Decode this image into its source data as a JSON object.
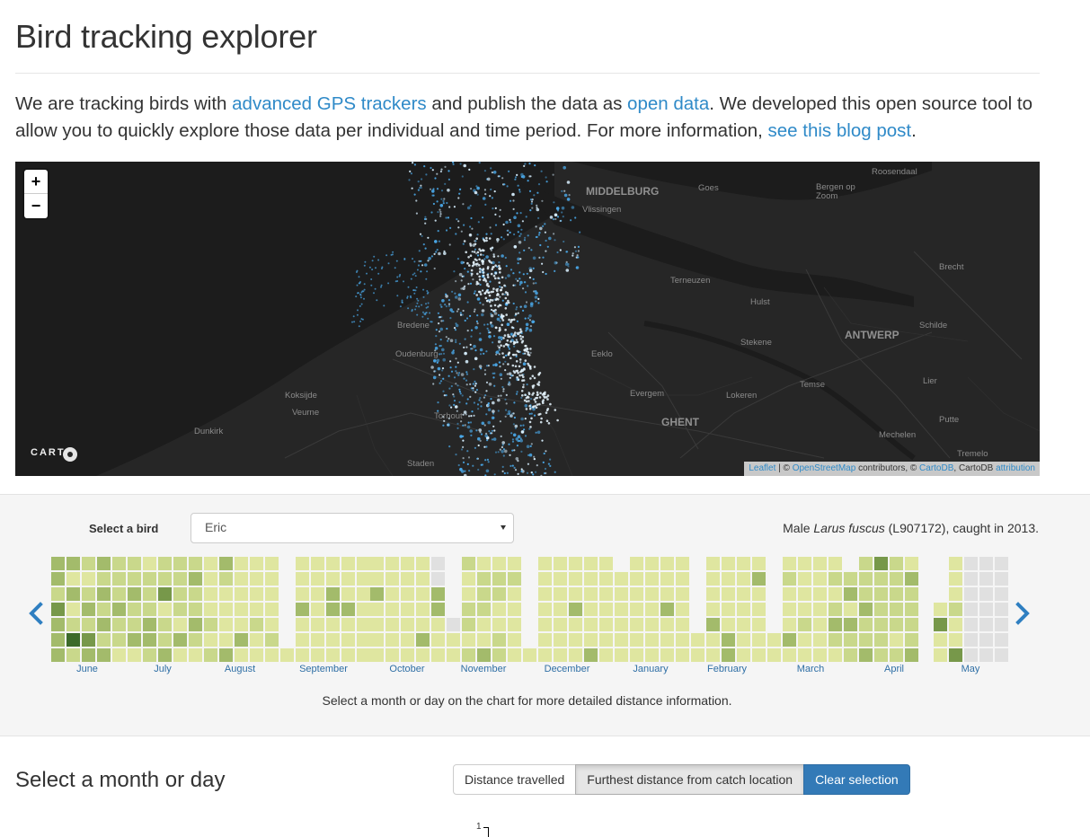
{
  "page": {
    "title": "Bird tracking explorer",
    "intro": {
      "t1": "We are tracking birds with ",
      "link1": "advanced GPS trackers",
      "t2": " and publish the data as ",
      "link2": "open data",
      "t3": ". We developed this open source tool to allow you to quickly explore those data per individual and time period. For more information, ",
      "link3": "see this blog post",
      "t4": "."
    }
  },
  "map": {
    "zoom_in": "+",
    "zoom_out": "−",
    "places": [
      {
        "name": "Roosendaal",
        "big": false
      },
      {
        "name": "MIDDELBURG",
        "big": true
      },
      {
        "name": "Goes",
        "big": false
      },
      {
        "name": "Bergen op Zoom",
        "big": false
      },
      {
        "name": "Vlissingen",
        "big": false
      },
      {
        "name": "Brecht",
        "big": false
      },
      {
        "name": "Terneuzen",
        "big": false
      },
      {
        "name": "Hulst",
        "big": false
      },
      {
        "name": "Bredene",
        "big": false
      },
      {
        "name": "Schilde",
        "big": false
      },
      {
        "name": "Stekene",
        "big": false
      },
      {
        "name": "ANTWERP",
        "big": true
      },
      {
        "name": "Oudenburg",
        "big": false
      },
      {
        "name": "Eeklo",
        "big": false
      },
      {
        "name": "Temse",
        "big": false
      },
      {
        "name": "Lier",
        "big": false
      },
      {
        "name": "Koksijde",
        "big": false
      },
      {
        "name": "Evergem",
        "big": false
      },
      {
        "name": "Lokeren",
        "big": false
      },
      {
        "name": "Veurne",
        "big": false
      },
      {
        "name": "Torhout",
        "big": false
      },
      {
        "name": "GHENT",
        "big": true
      },
      {
        "name": "Putte",
        "big": false
      },
      {
        "name": "Dunkirk",
        "big": false
      },
      {
        "name": "Mechelen",
        "big": false
      },
      {
        "name": "Staden",
        "big": false
      },
      {
        "name": "Tremelo",
        "big": false
      }
    ],
    "carto_logo": "CARTO",
    "attribution": {
      "leaflet": "Leaflet",
      "sep": " | © ",
      "osm": "OpenStreetMap",
      "contrib": " contributors, © ",
      "cartodb": "CartoDB",
      "cartodb_text": ", CartoDB ",
      "attr_link": "attribution"
    },
    "track_color": "#4aa8e8"
  },
  "calendar": {
    "select_label": "Select a bird",
    "selected_bird": "Eric",
    "bird_info": "Male Larus fuscus (L907172), caught in 2013.",
    "bird_info_parts": {
      "a": "Male ",
      "species": "Larus fuscus",
      "b": " (L907172), caught in 2013."
    },
    "months": [
      "June",
      "July",
      "August",
      "September",
      "October",
      "November",
      "December",
      "January",
      "February",
      "March",
      "April",
      "May"
    ],
    "prev_icon": "chevron-left-icon",
    "next_icon": "chevron-right-icon",
    "colors": {
      "level0": "#dfe6a0",
      "level1": "#c9d88b",
      "level2": "#a3bb6b",
      "level3": "#77984a",
      "level4": "#3c6a2a",
      "empty": "#e0e0e0"
    },
    "help_text": "Select a month or day on the chart for more detailed distance information."
  },
  "detail": {
    "title": "Select a month or day",
    "buttons": {
      "distance": "Distance travelled",
      "furthest": "Furthest distance from catch location",
      "clear": "Clear selection"
    },
    "axis_tick": "1"
  },
  "accent": "#337ab7",
  "link_color": "#2f8ac8"
}
